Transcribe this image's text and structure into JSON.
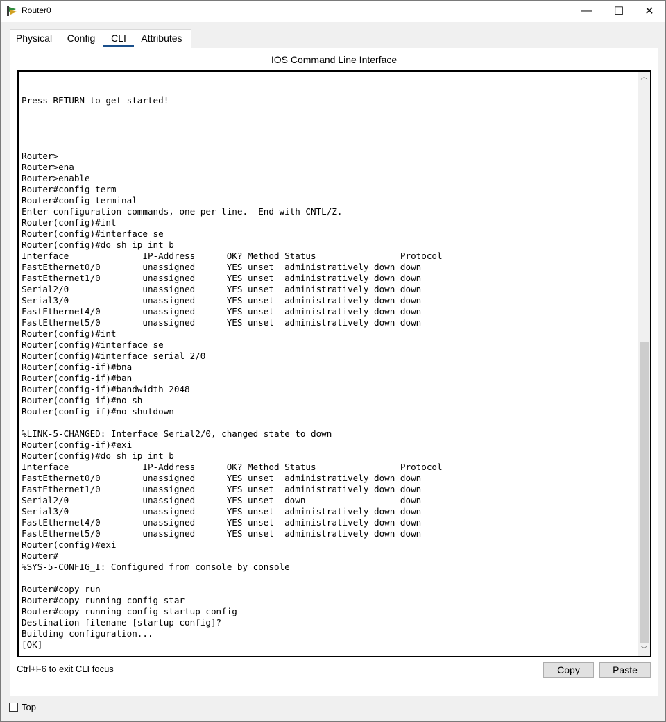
{
  "window": {
    "title": "Router0",
    "minimize_glyph": "—",
    "maximize_glyph": "☐",
    "close_glyph": "✕"
  },
  "tabs": [
    {
      "label": "Physical"
    },
    {
      "label": "Config"
    },
    {
      "label": "CLI"
    },
    {
      "label": "Attributes"
    }
  ],
  "active_tab": "CLI",
  "panel": {
    "title": "IOS Command Line Interface"
  },
  "cli": {
    "lines": [
      "Would you like to enter the initial configuration dialog? [yes/no]: no",
      "",
      "",
      "Press RETURN to get started!",
      "",
      "",
      "",
      "",
      "Router>",
      "Router>ena",
      "Router>enable",
      "Router#config term",
      "Router#config terminal",
      "Enter configuration commands, one per line.  End with CNTL/Z.",
      "Router(config)#int",
      "Router(config)#interface se",
      "Router(config)#do sh ip int b",
      "Interface              IP-Address      OK? Method Status                Protocol",
      "FastEthernet0/0        unassigned      YES unset  administratively down down",
      "FastEthernet1/0        unassigned      YES unset  administratively down down",
      "Serial2/0              unassigned      YES unset  administratively down down",
      "Serial3/0              unassigned      YES unset  administratively down down",
      "FastEthernet4/0        unassigned      YES unset  administratively down down",
      "FastEthernet5/0        unassigned      YES unset  administratively down down",
      "Router(config)#int",
      "Router(config)#interface se",
      "Router(config)#interface serial 2/0",
      "Router(config-if)#bna",
      "Router(config-if)#ban",
      "Router(config-if)#bandwidth 2048",
      "Router(config-if)#no sh",
      "Router(config-if)#no shutdown",
      "",
      "%LINK-5-CHANGED: Interface Serial2/0, changed state to down",
      "Router(config-if)#exi",
      "Router(config)#do sh ip int b",
      "Interface              IP-Address      OK? Method Status                Protocol",
      "FastEthernet0/0        unassigned      YES unset  administratively down down",
      "FastEthernet1/0        unassigned      YES unset  administratively down down",
      "Serial2/0              unassigned      YES unset  down                  down",
      "Serial3/0              unassigned      YES unset  administratively down down",
      "FastEthernet4/0        unassigned      YES unset  administratively down down",
      "FastEthernet5/0        unassigned      YES unset  administratively down down",
      "Router(config)#exi",
      "Router#",
      "%SYS-5-CONFIG_I: Configured from console by console",
      "",
      "Router#copy run",
      "Router#copy running-config star",
      "Router#copy running-config startup-config",
      "Destination filename [startup-config]?",
      "Building configuration...",
      "[OK]",
      "Router#"
    ],
    "scroll_up_glyph": "︿",
    "scroll_down_glyph": "﹀"
  },
  "footer": {
    "hint": "Ctrl+F6 to exit CLI focus",
    "copy_label": "Copy",
    "paste_label": "Paste"
  },
  "top_checkbox": {
    "label": "Top",
    "checked": false
  }
}
